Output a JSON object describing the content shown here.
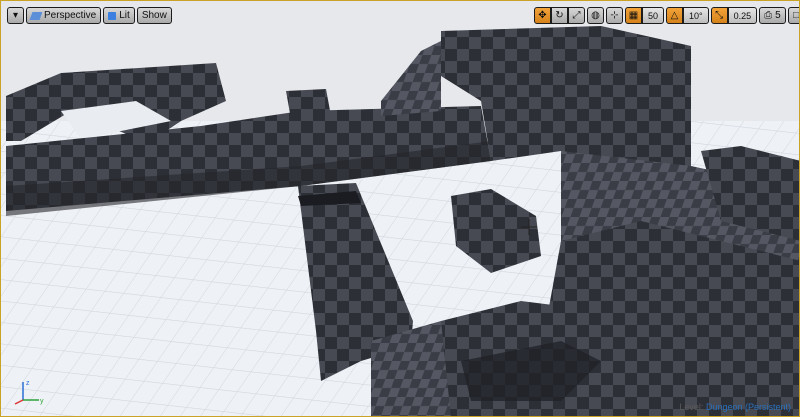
{
  "toolbar_left": {
    "menu_icon": "chevron-down-icon",
    "perspective_label": "Perspective",
    "lit_label": "Lit",
    "show_label": "Show"
  },
  "toolbar_right": {
    "grid_snap_value": "50",
    "rotation_snap_value": "10°",
    "scale_snap_value": "0.25",
    "camera_speed_value": "5"
  },
  "status": {
    "level_prefix": "Level:",
    "level_name": "Dungeon (Persistent)"
  },
  "colors": {
    "accent": "#f2a33a",
    "floor": "#e9edf2",
    "grid_line": "#c8cfd8",
    "block_dark": "#2d2f36",
    "block_light": "#4a4d56",
    "level_name": "#2a6fb8"
  }
}
